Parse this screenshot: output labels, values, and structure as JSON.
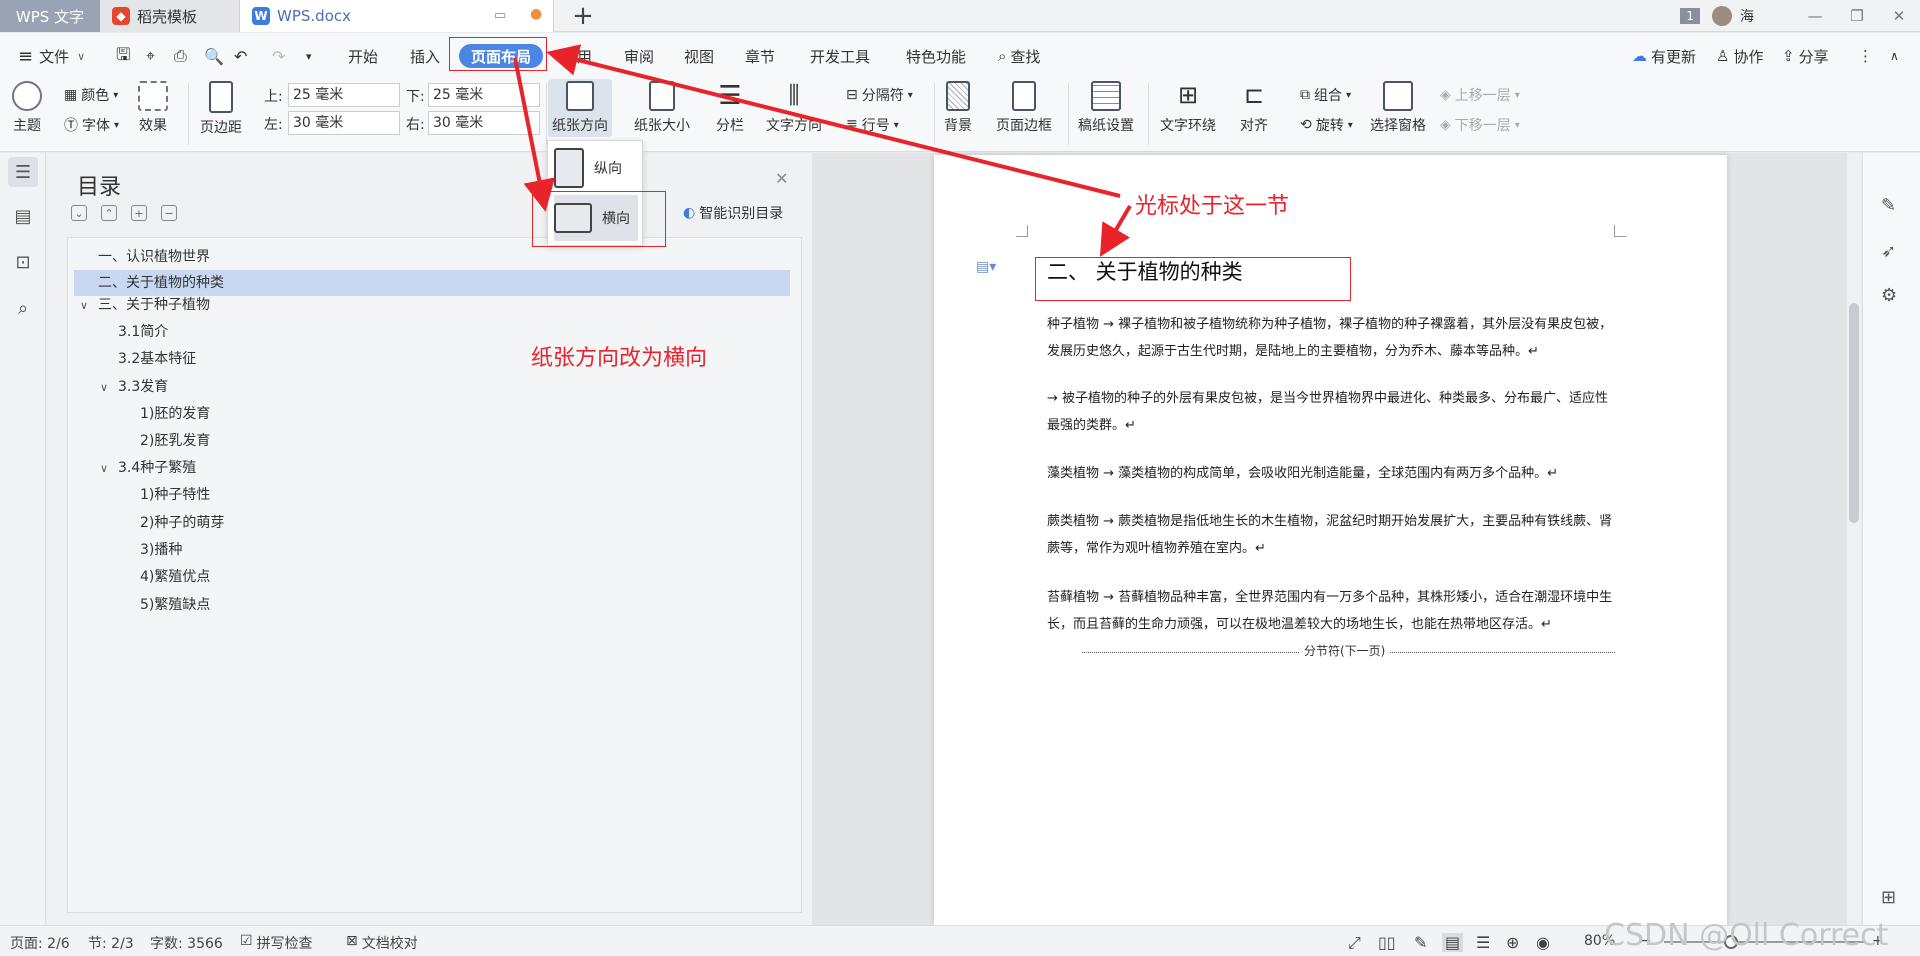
{
  "tabs": {
    "app": "WPS 文字",
    "template": "稻壳模板",
    "doc": "WPS.docx",
    "new_tab": "+",
    "badge": "1",
    "user": "海"
  },
  "menu": {
    "file": "文件",
    "items": [
      "开始",
      "插入",
      "页面布局",
      "引用",
      "审阅",
      "视图",
      "章节",
      "开发工具",
      "特色功能"
    ],
    "search": "查找",
    "update": "有更新",
    "collab": "协作",
    "share": "分享"
  },
  "ribbon": {
    "theme": "主题",
    "color": "颜色",
    "font": "字体",
    "effect": "效果",
    "margins": "页边距",
    "top_label": "上:",
    "top_value": "25 毫米",
    "bottom_label": "下:",
    "bottom_value": "25 毫米",
    "left_label": "左:",
    "left_value": "30 毫米",
    "right_label": "右:",
    "right_value": "30 毫米",
    "orientation": "纸张方向",
    "size": "纸张大小",
    "columns": "分栏",
    "text_direction": "文字方向",
    "breaks": "分隔符",
    "line_numbers": "行号",
    "background": "背景",
    "page_border": "页面边框",
    "grid_paper": "稿纸设置",
    "wrap": "文字环绕",
    "align": "对齐",
    "group": "组合",
    "rotate": "旋转",
    "selection_pane": "选择窗格",
    "bring_forward": "上移一层",
    "send_backward": "下移一层"
  },
  "orientation_menu": {
    "portrait": "纵向",
    "landscape": "横向"
  },
  "toc": {
    "title": "目录",
    "smart": "智能识别目录",
    "items": [
      {
        "text": "一、认识植物世界"
      },
      {
        "text": "二、关于植物的种类"
      },
      {
        "text": "三、关于种子植物"
      },
      {
        "text": "3.1简介"
      },
      {
        "text": "3.2基本特征"
      },
      {
        "text": "3.3发育"
      },
      {
        "text": "1)胚的发育"
      },
      {
        "text": "2)胚乳发育"
      },
      {
        "text": "3.4种子繁殖"
      },
      {
        "text": "1)种子特性"
      },
      {
        "text": "2)种子的萌芽"
      },
      {
        "text": "3)播种"
      },
      {
        "text": "4)繁殖优点"
      },
      {
        "text": "5)繁殖缺点"
      }
    ]
  },
  "document": {
    "heading": "二、  关于植物的种类",
    "paragraphs": [
      "种子植物 → 裸子植物和被子植物统称为种子植物，裸子植物的种子裸露着，其外层没有果皮包被，发展历史悠久，起源于古生代时期，是陆地上的主要植物，分为乔木、藤本等品种。↵",
      "→ 被子植物的种子的外层有果皮包被，是当今世界植物界中最进化、种类最多、分布最广、适应性最强的类群。↵",
      "藻类植物 → 藻类植物的构成简单，会吸收阳光制造能量，全球范围内有两万多个品种。↵",
      "蕨类植物 → 蕨类植物是指低地生长的木生植物，泥盆纪时期开始发展扩大，主要品种有铁线蕨、肾蕨等，常作为观叶植物养殖在室内。↵",
      "苔藓植物 → 苔藓植物品种丰富，全世界范围内有一万多个品种，其株形矮小，适合在潮湿环境中生长，而且苔藓的生命力顽强，可以在极地温差较大的场地生长，也能在热带地区存活。↵"
    ],
    "section_break": "分节符(下一页)"
  },
  "annotations": {
    "cursor_note": "光标处于这一节",
    "orientation_note": "纸张方向改为横向",
    "color": "#e8242a"
  },
  "status": {
    "page": "页面: 2/6",
    "section": "节: 2/3",
    "words": "字数: 3566",
    "spell": "拼写检查",
    "proof": "文档校对",
    "zoom": "80%",
    "watermark": "CSDN @Oll Correct"
  }
}
